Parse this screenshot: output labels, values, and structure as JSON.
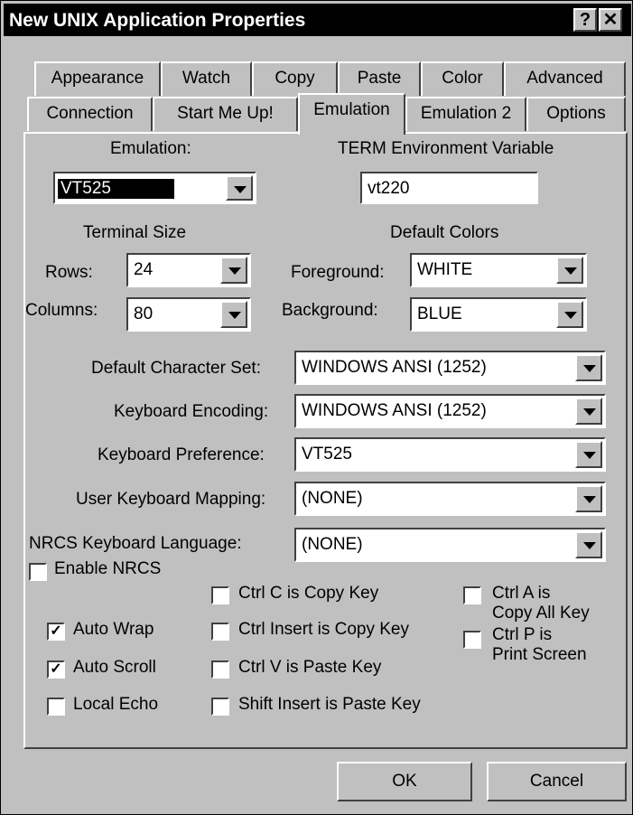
{
  "window": {
    "title": "New UNIX Application Properties",
    "help_button": "?",
    "close_button": "✕"
  },
  "tabs": {
    "row1": [
      "Appearance",
      "Watch",
      "Copy",
      "Paste",
      "Color",
      "Advanced"
    ],
    "row2": [
      "Connection",
      "Start Me Up!",
      "Emulation",
      "Emulation 2",
      "Options"
    ],
    "active": "Emulation"
  },
  "emulation": {
    "label": "Emulation:",
    "value": "VT525"
  },
  "term_env": {
    "label": "TERM Environment Variable",
    "value": "vt220"
  },
  "terminal_size": {
    "heading": "Terminal Size",
    "rows_label": "Rows:",
    "rows_value": "24",
    "columns_label": "Columns:",
    "columns_value": "80"
  },
  "default_colors": {
    "heading": "Default Colors",
    "foreground_label": "Foreground:",
    "foreground_value": "WHITE",
    "background_label": "Background:",
    "background_value": "BLUE"
  },
  "charset": {
    "label": "Default Character Set:",
    "value": "WINDOWS ANSI (1252)"
  },
  "keyboard_encoding": {
    "label": "Keyboard Encoding:",
    "value": "WINDOWS ANSI (1252)"
  },
  "keyboard_preference": {
    "label": "Keyboard Preference:",
    "value": "VT525"
  },
  "user_mapping": {
    "label": "User Keyboard Mapping:",
    "value": "(NONE)"
  },
  "nrcs_language": {
    "label": "NRCS Keyboard Language:",
    "value": "(NONE)"
  },
  "checkboxes": {
    "enable_nrcs": {
      "label": "Enable NRCS",
      "checked": false
    },
    "auto_wrap": {
      "label": "Auto Wrap",
      "checked": true
    },
    "auto_scroll": {
      "label": "Auto Scroll",
      "checked": true
    },
    "local_echo": {
      "label": "Local Echo",
      "checked": false
    },
    "ctrl_c": {
      "label": "Ctrl C is Copy Key",
      "checked": false
    },
    "ctrl_insert": {
      "label": "Ctrl Insert is Copy Key",
      "checked": false
    },
    "ctrl_v": {
      "label": "Ctrl V is Paste Key",
      "checked": false
    },
    "shift_insert": {
      "label": "Shift Insert is Paste Key",
      "checked": false
    },
    "ctrl_a": {
      "label_line1": "Ctrl A is",
      "label_line2": "Copy All Key",
      "checked": false
    },
    "ctrl_p": {
      "label_line1": "Ctrl P is",
      "label_line2": "Print Screen",
      "checked": false
    }
  },
  "check_mark": "✓",
  "buttons": {
    "ok": "OK",
    "cancel": "Cancel"
  }
}
